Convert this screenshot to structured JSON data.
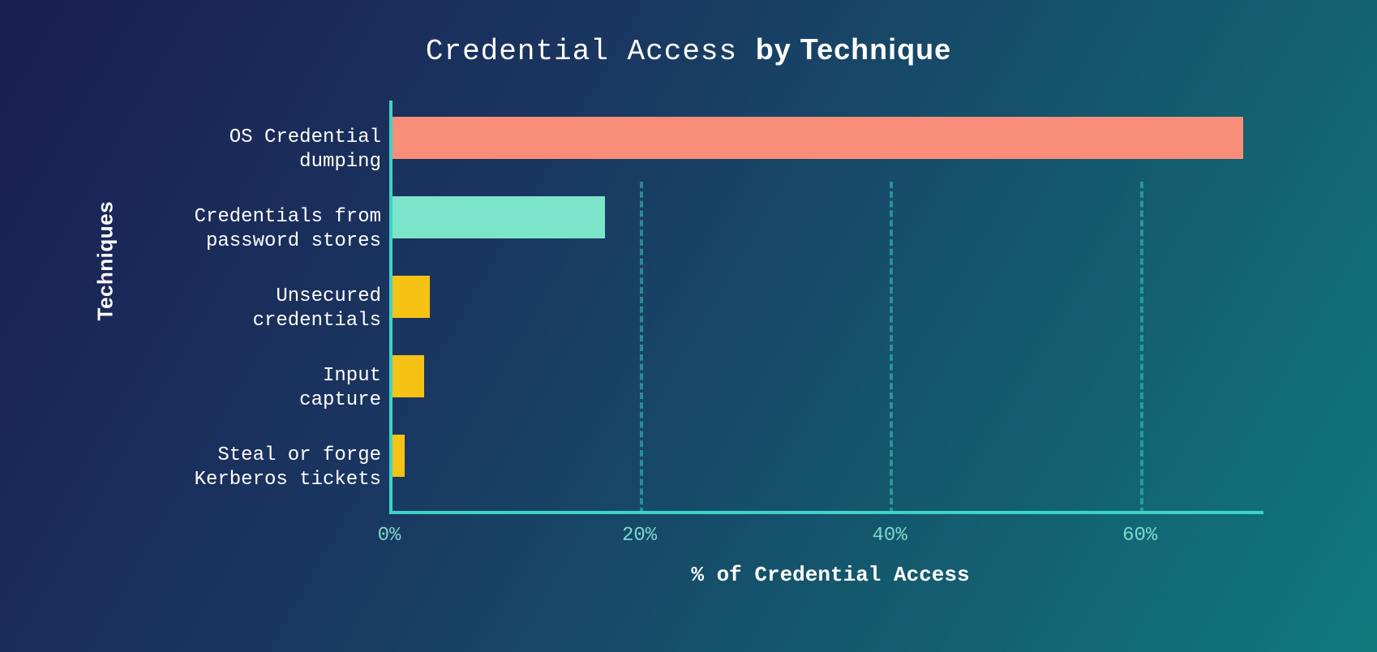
{
  "chart_data": {
    "type": "bar",
    "title_part1": "Credential Access ",
    "title_part2": "by Technique",
    "ylabel": "Techniques",
    "xlabel": "% of Credential Access",
    "xlim": [
      0,
      70
    ],
    "x_ticks": [
      0,
      20,
      40,
      60
    ],
    "x_tick_labels": [
      "0%",
      "20%",
      "40%",
      "60%"
    ],
    "categories": [
      "OS Credential dumping",
      "Credentials from password stores",
      "Unsecured credentials",
      "Input capture",
      "Steal or forge Kerberos tickets"
    ],
    "category_labels": [
      [
        "OS Credential",
        "dumping"
      ],
      [
        "Credentials from",
        "password stores"
      ],
      [
        "Unsecured",
        "credentials"
      ],
      [
        "Input",
        "capture"
      ],
      [
        "Steal or forge",
        "Kerberos tickets"
      ]
    ],
    "values": [
      68,
      17,
      3,
      2.5,
      1
    ],
    "colors": [
      "#f88e7a",
      "#7ce5c9",
      "#f6c315",
      "#f6c315",
      "#f6c315"
    ]
  }
}
